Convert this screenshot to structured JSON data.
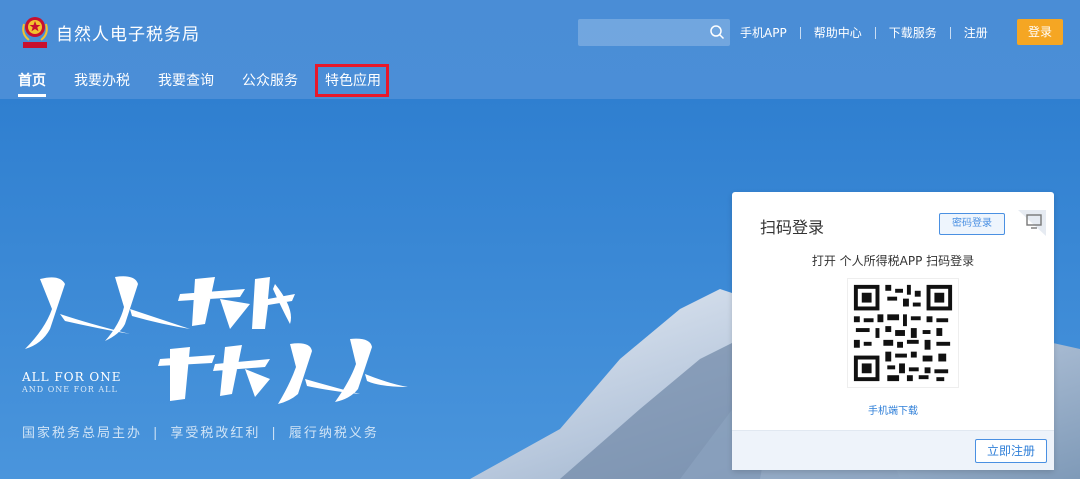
{
  "header": {
    "site_title": "自然人电子税务局",
    "search_placeholder": "",
    "links": [
      "手机APP",
      "帮助中心",
      "下载服务",
      "注册"
    ],
    "login_label": "登录"
  },
  "nav": {
    "items": [
      "首页",
      "我要办税",
      "我要查询",
      "公众服务",
      "特色应用"
    ],
    "active_index": 0,
    "highlighted_index": 4
  },
  "hero": {
    "slogan_line1": "人人为我",
    "slogan_line2": "我为人人",
    "english_line1": "ALL FOR ONE",
    "english_line2": "AND ONE FOR ALL",
    "tagline": [
      "国家税务总局主办",
      "享受税改红利",
      "履行纳税义务"
    ]
  },
  "login_card": {
    "title": "扫码登录",
    "password_login_label": "密码登录",
    "scan_instruction": "打开 个人所得税APP 扫码登录",
    "download_link": "手机端下载",
    "register_label": "立即注册"
  },
  "colors": {
    "accent_orange": "#f5a623",
    "highlight_red": "#e8182a",
    "link_blue": "#2f7fd8"
  },
  "icons": [
    "emblem-logo-icon",
    "search-icon",
    "pc-monitor-icon",
    "qr-code-icon"
  ]
}
